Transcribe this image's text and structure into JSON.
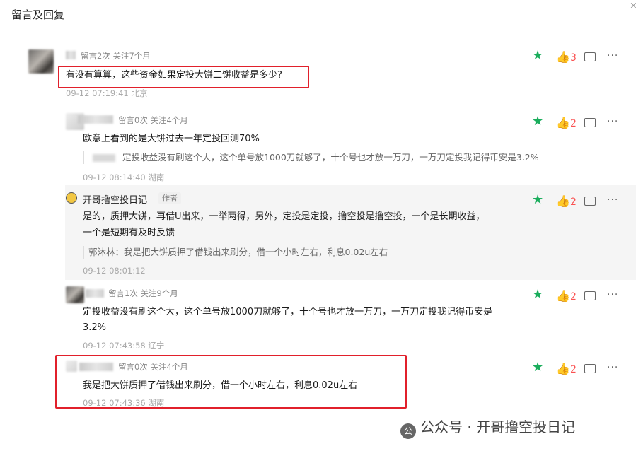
{
  "header": {
    "title": "留言及回复",
    "close_glyph": "×"
  },
  "watermark": {
    "logo": "公",
    "text": "公众号 · 开哥撸空投日记"
  },
  "comments": [
    {
      "meta": "留言2次 关注7个月",
      "text": "有没有算算，这些资金如果定投大饼二饼收益是多少?",
      "time": "09-12 07:19:41 北京",
      "likes": "3"
    },
    {
      "meta": "留言0次 关注4个月",
      "text": "欧意上看到的是大饼过去一年定投回测70%",
      "quote": "定投收益没有刷这个大，这个单号放1000刀就够了，十个号也才放一万刀，一万刀定投我记得币安是3.2%",
      "time": "09-12 08:14:40 湖南",
      "likes": "2"
    },
    {
      "nick": "开哥撸空投日记",
      "badge": "作者",
      "text1": "是的，质押大饼，再借U出来，一举两得，另外，定投是定投，撸空投是撸空投，一个是长期收益，",
      "text2": "一个是短期有及时反馈",
      "quote": "郭沐林：我是把大饼质押了借钱出来刷分，借一个小时左右，利息0.02u左右",
      "time": "09-12 08:01:12",
      "likes": "2"
    },
    {
      "meta": "留言1次 关注9个月",
      "text1": "定投收益没有刷这个大，这个单号放1000刀就够了，十个号也才放一万刀，一万刀定投我记得币安是",
      "text2": "3.2%",
      "time": "09-12 07:43:58 辽宁",
      "likes": "2"
    },
    {
      "meta": "留言0次 关注4个月",
      "text": "我是把大饼质押了借钱出来刷分，借一个小时左右，利息0.02u左右",
      "time": "09-12 07:43:36 湖南",
      "likes": "2"
    }
  ],
  "icons": {
    "star": "star-icon",
    "thumb": "thumbs-up-icon",
    "comment": "comment-icon",
    "more": "more-icon"
  },
  "colors": {
    "accent_green": "#1aad5c",
    "like_red": "#fa5151",
    "highlight": "#e1202b"
  }
}
